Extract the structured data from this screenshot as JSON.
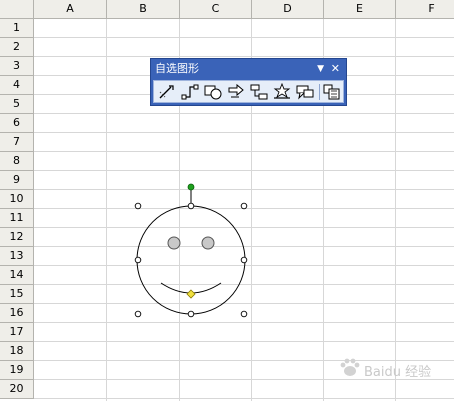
{
  "spreadsheet": {
    "columns": [
      "A",
      "B",
      "C",
      "D",
      "E",
      "F"
    ],
    "rows": [
      "1",
      "2",
      "3",
      "4",
      "5",
      "6",
      "7",
      "8",
      "9",
      "10",
      "11",
      "12",
      "13",
      "14",
      "15",
      "16",
      "17",
      "18",
      "19",
      "20"
    ]
  },
  "toolbar": {
    "title": "自选图形",
    "dropdown_glyph": "▼",
    "close_glyph": "✕",
    "buttons": [
      {
        "icon": "lines-icon"
      },
      {
        "icon": "connectors-icon"
      },
      {
        "icon": "basic-shapes-icon"
      },
      {
        "icon": "block-arrows-icon"
      },
      {
        "icon": "flowchart-icon"
      },
      {
        "icon": "stars-banners-icon"
      },
      {
        "icon": "callouts-icon"
      },
      {
        "icon": "more-autoshapes-icon"
      }
    ]
  },
  "shape": {
    "type": "smiley-face",
    "selected": true,
    "outline_color": "#000000",
    "eye_color": "#c8c8c8",
    "rotate_handle_color": "#1ea01e",
    "adjust_handle_color": "#f0e040"
  },
  "watermark": {
    "text": "Baidu 经验"
  }
}
